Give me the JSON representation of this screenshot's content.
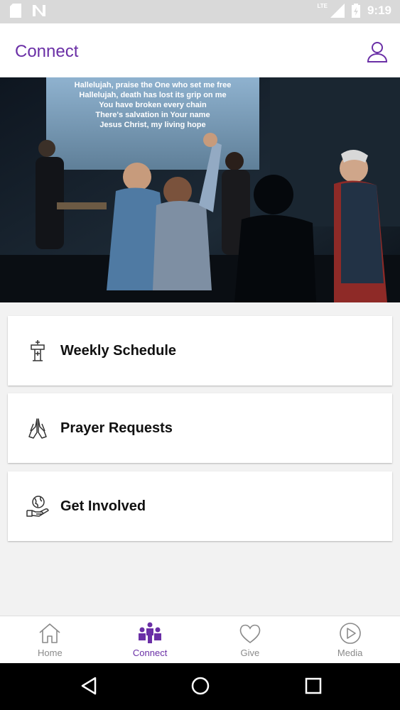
{
  "status_bar": {
    "network": "LTE",
    "time": "9:19"
  },
  "app_bar": {
    "title": "Connect"
  },
  "hero": {
    "lyrics": [
      "Hallelujah, praise the One who set me free",
      "Hallelujah, death has lost its grip on me",
      "You have broken every chain",
      "There's salvation in Your name",
      "Jesus Christ, my living hope"
    ]
  },
  "cards": [
    {
      "label": "Weekly Schedule",
      "icon": "pulpit-icon"
    },
    {
      "label": "Prayer Requests",
      "icon": "praying-hands-icon"
    },
    {
      "label": "Get Involved",
      "icon": "globe-hand-icon"
    }
  ],
  "bottom_nav": {
    "items": [
      {
        "label": "Home",
        "icon": "home-icon",
        "active": false
      },
      {
        "label": "Connect",
        "icon": "people-icon",
        "active": true
      },
      {
        "label": "Give",
        "icon": "heart-icon",
        "active": false
      },
      {
        "label": "Media",
        "icon": "play-icon",
        "active": false
      }
    ]
  },
  "colors": {
    "accent": "#6a2fa6",
    "inactive": "#8a8a8a",
    "background": "#f2f2f2"
  }
}
